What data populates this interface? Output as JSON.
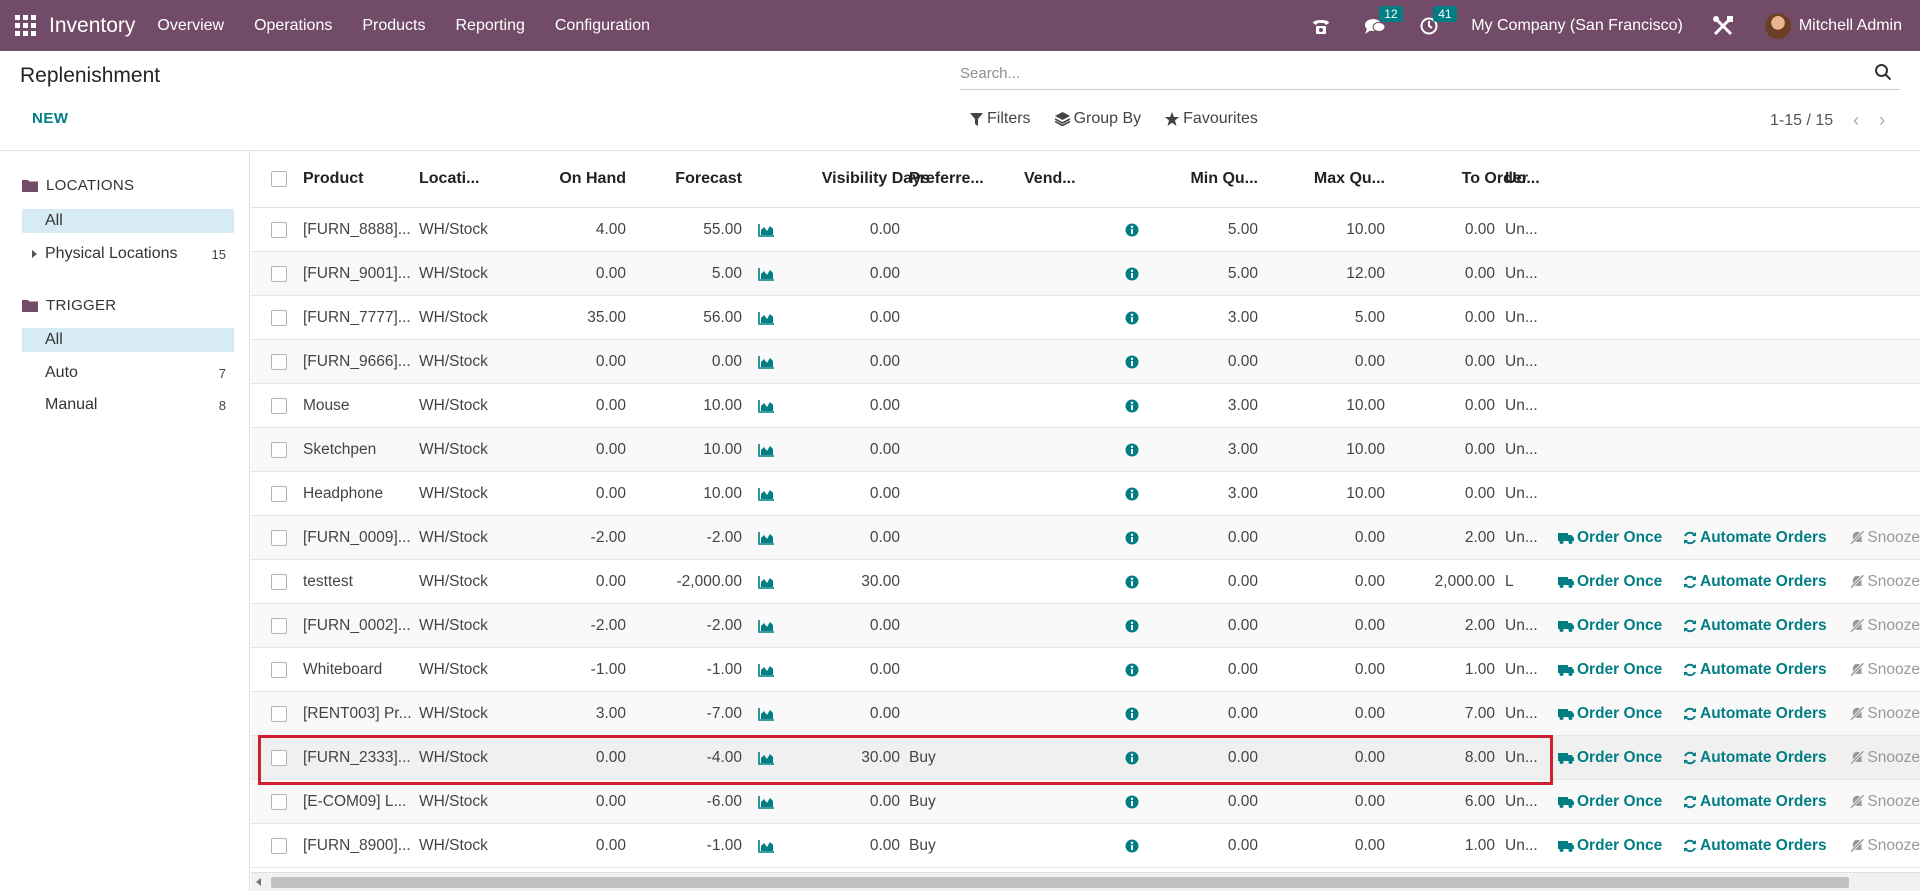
{
  "navbar": {
    "brand": "Inventory",
    "menu": [
      "Overview",
      "Operations",
      "Products",
      "Reporting",
      "Configuration"
    ],
    "messages_count": "12",
    "activities_count": "41",
    "company": "My Company (San Francisco)",
    "user": "Mitchell Admin"
  },
  "control_panel": {
    "title": "Replenishment",
    "new_label": "NEW",
    "search_placeholder": "Search...",
    "filters_label": "Filters",
    "group_by_label": "Group By",
    "favourites_label": "Favourites",
    "pager": "1-15 / 15"
  },
  "sidebar": {
    "sections": [
      {
        "title": "LOCATIONS",
        "items": [
          {
            "label": "All",
            "count": "",
            "active": true
          },
          {
            "label": "Physical Locations",
            "count": "15",
            "active": false
          }
        ]
      },
      {
        "title": "TRIGGER",
        "items": [
          {
            "label": "All",
            "count": "",
            "active": true
          },
          {
            "label": "Auto",
            "count": "7",
            "active": false
          },
          {
            "label": "Manual",
            "count": "8",
            "active": false
          }
        ]
      }
    ]
  },
  "table": {
    "columns": [
      "Product",
      "Locati...",
      "On Hand",
      "Forecast",
      "Visibility Days",
      "Preferre...",
      "Vend...",
      "Min Qu...",
      "Max Qu...",
      "To Order",
      "Uo..."
    ],
    "actions": {
      "order_once": "Order Once",
      "automate": "Automate Orders",
      "snooze": "Snooze"
    },
    "rows": [
      {
        "product": "[FURN_8888]...",
        "location": "WH/Stock",
        "on_hand": "4.00",
        "forecast": "55.00",
        "visibility": "0.00",
        "route": "",
        "min": "5.00",
        "max": "10.00",
        "to_order": "0.00",
        "uom": "Un...",
        "actions": false
      },
      {
        "product": "[FURN_9001]...",
        "location": "WH/Stock",
        "on_hand": "0.00",
        "forecast": "5.00",
        "visibility": "0.00",
        "route": "",
        "min": "5.00",
        "max": "12.00",
        "to_order": "0.00",
        "uom": "Un...",
        "actions": false
      },
      {
        "product": "[FURN_7777]...",
        "location": "WH/Stock",
        "on_hand": "35.00",
        "forecast": "56.00",
        "visibility": "0.00",
        "route": "",
        "min": "3.00",
        "max": "5.00",
        "to_order": "0.00",
        "uom": "Un...",
        "actions": false
      },
      {
        "product": "[FURN_9666]...",
        "location": "WH/Stock",
        "on_hand": "0.00",
        "forecast": "0.00",
        "visibility": "0.00",
        "route": "",
        "min": "0.00",
        "max": "0.00",
        "to_order": "0.00",
        "uom": "Un...",
        "actions": false
      },
      {
        "product": "Mouse",
        "location": "WH/Stock",
        "on_hand": "0.00",
        "forecast": "10.00",
        "visibility": "0.00",
        "route": "",
        "min": "3.00",
        "max": "10.00",
        "to_order": "0.00",
        "uom": "Un...",
        "actions": false
      },
      {
        "product": "Sketchpen",
        "location": "WH/Stock",
        "on_hand": "0.00",
        "forecast": "10.00",
        "visibility": "0.00",
        "route": "",
        "min": "3.00",
        "max": "10.00",
        "to_order": "0.00",
        "uom": "Un...",
        "actions": false
      },
      {
        "product": "Headphone",
        "location": "WH/Stock",
        "on_hand": "0.00",
        "forecast": "10.00",
        "visibility": "0.00",
        "route": "",
        "min": "3.00",
        "max": "10.00",
        "to_order": "0.00",
        "uom": "Un...",
        "actions": false
      },
      {
        "product": "[FURN_0009]...",
        "location": "WH/Stock",
        "on_hand": "-2.00",
        "forecast": "-2.00",
        "visibility": "0.00",
        "route": "",
        "min": "0.00",
        "max": "0.00",
        "to_order": "2.00",
        "uom": "Un...",
        "actions": true
      },
      {
        "product": "testtest",
        "location": "WH/Stock",
        "on_hand": "0.00",
        "forecast": "-2,000.00",
        "visibility": "30.00",
        "route": "",
        "min": "0.00",
        "max": "0.00",
        "to_order": "2,000.00",
        "uom": "L",
        "actions": true
      },
      {
        "product": "[FURN_0002]...",
        "location": "WH/Stock",
        "on_hand": "-2.00",
        "forecast": "-2.00",
        "visibility": "0.00",
        "route": "",
        "min": "0.00",
        "max": "0.00",
        "to_order": "2.00",
        "uom": "Un...",
        "actions": true
      },
      {
        "product": "Whiteboard",
        "location": "WH/Stock",
        "on_hand": "-1.00",
        "forecast": "-1.00",
        "visibility": "0.00",
        "route": "",
        "min": "0.00",
        "max": "0.00",
        "to_order": "1.00",
        "uom": "Un...",
        "actions": true
      },
      {
        "product": "[RENT003] Pr...",
        "location": "WH/Stock",
        "on_hand": "3.00",
        "forecast": "-7.00",
        "visibility": "0.00",
        "route": "",
        "min": "0.00",
        "max": "0.00",
        "to_order": "7.00",
        "uom": "Un...",
        "actions": true
      },
      {
        "product": "[FURN_2333]...",
        "location": "WH/Stock",
        "on_hand": "0.00",
        "forecast": "-4.00",
        "visibility": "30.00",
        "route": "Buy",
        "min": "0.00",
        "max": "0.00",
        "to_order": "8.00",
        "uom": "Un...",
        "actions": true,
        "highlight": true
      },
      {
        "product": "[E-COM09] L...",
        "location": "WH/Stock",
        "on_hand": "0.00",
        "forecast": "-6.00",
        "visibility": "0.00",
        "route": "Buy",
        "min": "0.00",
        "max": "0.00",
        "to_order": "6.00",
        "uom": "Un...",
        "actions": true
      },
      {
        "product": "[FURN_8900]...",
        "location": "WH/Stock",
        "on_hand": "0.00",
        "forecast": "-1.00",
        "visibility": "0.00",
        "route": "Buy",
        "min": "0.00",
        "max": "0.00",
        "to_order": "1.00",
        "uom": "Un...",
        "actions": true
      }
    ]
  },
  "colors": {
    "navbar": "#714b67",
    "accent": "#017e84",
    "highlight_border": "#d0202b"
  }
}
